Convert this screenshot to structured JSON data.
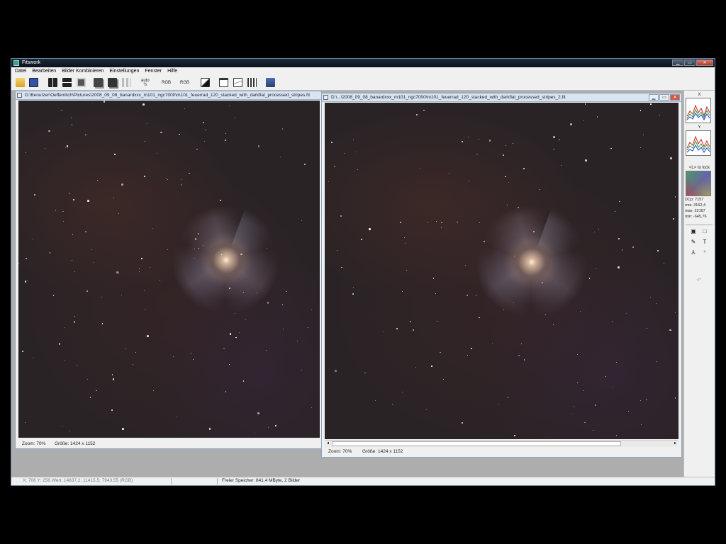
{
  "app": {
    "title": "Fitswork"
  },
  "window_buttons": {
    "minimize": "▁",
    "maximize": "▭",
    "close": "✕"
  },
  "menu": [
    "Datei",
    "Bearbeiten",
    "Bilder Kombinieren",
    "Einstellungen",
    "Fenster",
    "Hilfe"
  ],
  "toolbar": {
    "auto_label": "auto",
    "auto_sub": "½",
    "rgb_label_1": "RGB",
    "rgb_label_2": "RGB",
    "icons": [
      "open-folder-icon",
      "save-icon",
      "flip-icon",
      "mirror-icon",
      "copy-icon",
      "stack-icon",
      "arrange-icon",
      "contrast-icon",
      "window-icon",
      "graph-icon",
      "grid-icon",
      "tool-icon"
    ]
  },
  "windows": [
    {
      "title": "D:\\Benutzer\\Oeffentlich\\Pictures\\2008_09_08_banardxxx_m101_ngc7000\\m101_feuerrad_120_stacked_with_darkflat_processed_stripes.fit",
      "zoom": "Zoom: 70%",
      "size": "Größe: 1424 x 1152"
    },
    {
      "title": "D:\\...\\2008_09_08_banardxxx_m101_ngc7000\\m101_feuerrad_120_stacked_with_darkflat_processed_stripes_2.fit",
      "zoom": "Zoom: 70%",
      "size": "Größe: 1424 x 1152"
    }
  ],
  "right_panel": {
    "x_label": "X",
    "y_label": "Y",
    "lock_label": "<L> to lock",
    "dcp": "DCp: 7157",
    "rms": "rms: 3162,4",
    "max": "max: 22167",
    "min": "min: -645,76"
  },
  "status": {
    "coords": "X: 706  Y: 256  Wert: 14837,2; 11415,5; 7943,55 (RGB)",
    "memory": "Freier Speicher: 841,4 MByte, 2 Bilder"
  },
  "colors": {
    "plot_red": "#d02020",
    "plot_green": "#20a040",
    "plot_blue": "#2040d0"
  }
}
